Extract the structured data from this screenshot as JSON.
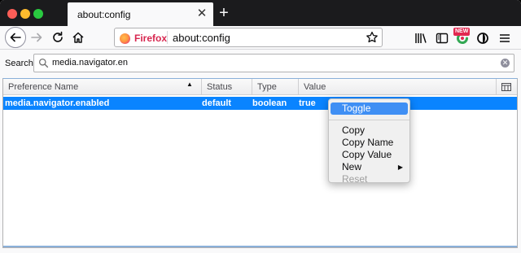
{
  "tab": {
    "title": "about:config",
    "close": "✕",
    "new_tab": "+"
  },
  "urlbar": {
    "identity": "Firefox",
    "url": "about:config"
  },
  "toolbar": {
    "new_badge": "NEW"
  },
  "search": {
    "label": "Search:",
    "value": "media.navigator.en",
    "clear": "✕"
  },
  "table": {
    "columns": [
      "Preference Name",
      "Status",
      "Type",
      "Value"
    ],
    "sort_indicator": "▲",
    "rows": [
      {
        "name": "media.navigator.enabled",
        "status": "default",
        "type": "boolean",
        "value": "true"
      }
    ]
  },
  "context_menu": {
    "items": [
      {
        "label": "Toggle",
        "state": "highlighted"
      },
      {
        "label": "Copy",
        "state": "normal"
      },
      {
        "label": "Copy Name",
        "state": "normal"
      },
      {
        "label": "Copy Value",
        "state": "normal"
      },
      {
        "label": "New",
        "state": "normal",
        "submenu_arrow": "▶"
      },
      {
        "label": "Reset",
        "state": "disabled"
      }
    ]
  },
  "colors": {
    "selection": "#0a84ff",
    "menu_highlight": "#3f8ff4",
    "tabbar": "#1b1b1d",
    "identity": "#d7264f"
  },
  "icons": [
    "back-arrow-icon",
    "forward-arrow-icon",
    "reload-icon",
    "home-icon",
    "firefox-logo-icon",
    "bookmark-star-icon",
    "library-icon",
    "sidebar-icon",
    "extension-icon",
    "account-icon",
    "hamburger-menu-icon",
    "search-icon",
    "column-picker-icon"
  ]
}
